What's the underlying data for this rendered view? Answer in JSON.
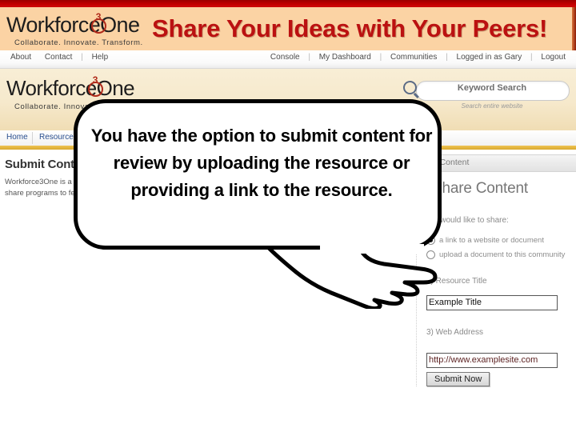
{
  "slide": {
    "banner_title": "Share Your Ideas with Your Peers!",
    "accent_red": "#bb1111",
    "banner_bg": "#fbd3a4",
    "top_rule_color": "#c20000"
  },
  "callout": {
    "text": "You have the option to submit content for review by uploading the resource or providing a link to the resource."
  },
  "outer_site": {
    "logo": {
      "word1": "Workforc",
      "word2": "One",
      "sup": "3",
      "tagline": "Collaborate.  Innovate.  Transform."
    },
    "util_left": [
      "About",
      "Contact",
      "Help"
    ],
    "util_right": [
      "Console",
      "My Dashboard",
      "Communities",
      "Logged in as Gary",
      "Logout"
    ]
  },
  "inner_page": {
    "logo": {
      "word1": "Workforc",
      "word2": "One",
      "sup": "3",
      "tagline": "Collaborate.  Innovate.  Transform."
    },
    "search": {
      "placeholder": "Keyword Search",
      "subtext": "Search entire website",
      "icon": "magnifier-icon"
    },
    "nav": [
      "Home",
      "Resources"
    ],
    "left": {
      "heading": "Submit Content",
      "body": "Workforce3One is a tool for Registered Users. Share, share programs to fellow colleagues"
    },
    "tab": {
      "label": "Submit Content"
    },
    "section_heading": "Share Content",
    "form": {
      "q1_label": "1) I would like to share:",
      "options": [
        {
          "label": "a link to a website or document",
          "selected": true
        },
        {
          "label": "upload a document to this community",
          "selected": false
        }
      ],
      "q2_label": "2) Resource Title",
      "q2_value": "Example Title",
      "q3_label": "3) Web Address",
      "q3_value": "http://www.examplesite.com",
      "submit_label": "Submit Now"
    }
  }
}
